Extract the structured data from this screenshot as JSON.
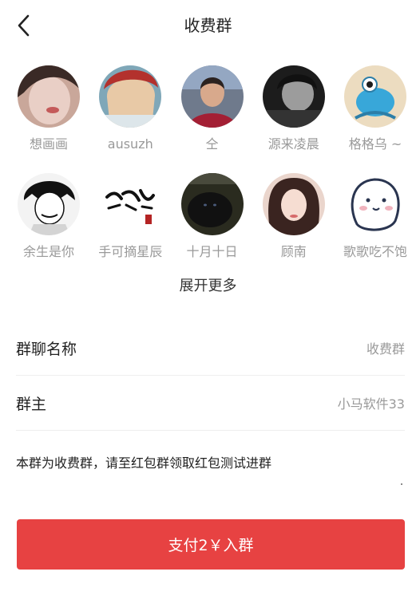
{
  "header": {
    "title": "收费群",
    "back_icon": "chevron-left-icon"
  },
  "members": {
    "row1": [
      {
        "name": "想画画"
      },
      {
        "name": "ausuzh"
      },
      {
        "name": "仝"
      },
      {
        "name": "源来凌晨"
      },
      {
        "name": "格格乌 ~"
      }
    ],
    "row2": [
      {
        "name": "余生是你"
      },
      {
        "name": "手可摘星辰"
      },
      {
        "name": "十月十日"
      },
      {
        "name": "顾南"
      },
      {
        "name": "歌歌吃不饱"
      }
    ],
    "expand_label": "展开更多"
  },
  "info": {
    "group_name_label": "群聊名称",
    "group_name_value": "收费群",
    "owner_label": "群主",
    "owner_value": "小马软件33"
  },
  "notice": "本群为收费群，请至红包群领取红包测试进群",
  "pay_button_label": "支付2￥入群",
  "colors": {
    "accent": "#e74242",
    "muted_text": "#999999"
  }
}
